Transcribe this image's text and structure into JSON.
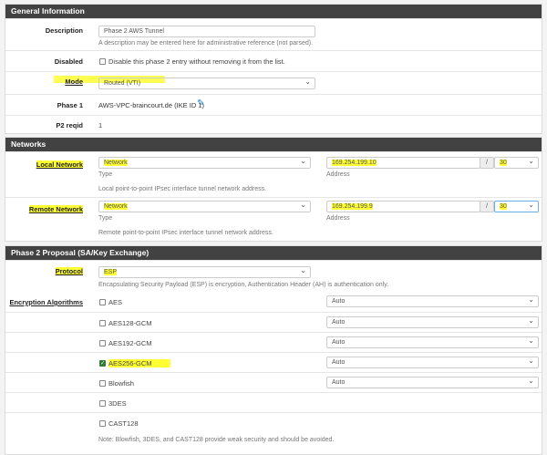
{
  "general": {
    "title": "General Information",
    "description": {
      "label": "Description",
      "value": "Phase 2 AWS Tunnel",
      "help": "A description may be entered here for administrative reference (not parsed)."
    },
    "disabled": {
      "label": "Disabled",
      "text": "Disable this phase 2 entry without removing it from the list.",
      "checked": false
    },
    "mode": {
      "label": "Mode",
      "value": "Routed (VTI)"
    },
    "phase1": {
      "label": "Phase 1",
      "value": "AWS-VPC-braincourt.de (IKE ID 1)"
    },
    "p2reqid": {
      "label": "P2 reqid",
      "value": "1"
    }
  },
  "networks": {
    "title": "Networks",
    "local": {
      "label": "Local Network",
      "type": "Network",
      "type_caption": "Type",
      "address": "169.254.199.10",
      "address_caption": "Address",
      "slash": "/",
      "mask": "30",
      "help": "Local point-to-point IPsec interface tunnel network address."
    },
    "remote": {
      "label": "Remote Network",
      "type": "Network",
      "type_caption": "Type",
      "address": "169.254.199.9",
      "address_caption": "Address",
      "slash": "/",
      "mask": "30",
      "help": "Remote point-to-point IPsec interface tunnel network address."
    }
  },
  "phase2": {
    "title": "Phase 2 Proposal (SA/Key Exchange)",
    "protocol": {
      "label": "Protocol",
      "value": "ESP",
      "help": "Encapsulating Security Payload (ESP) is encryption, Authentication Header (AH) is authentication only."
    },
    "enc_label": "Encryption Algorithms",
    "algorithms": [
      {
        "name": "AES",
        "checked": false,
        "keylen": "Auto"
      },
      {
        "name": "AES128-GCM",
        "checked": false,
        "keylen": "Auto"
      },
      {
        "name": "AES192-GCM",
        "checked": false,
        "keylen": "Auto"
      },
      {
        "name": "AES256-GCM",
        "checked": true,
        "keylen": "Auto"
      },
      {
        "name": "Blowfish",
        "checked": false,
        "keylen": "Auto"
      },
      {
        "name": "3DES",
        "checked": false
      },
      {
        "name": "CAST128",
        "checked": false
      }
    ],
    "note": "Note: Blowfish, 3DES, and CAST128 provide weak security and should be avoided."
  },
  "highlight_color": "#ffff33"
}
